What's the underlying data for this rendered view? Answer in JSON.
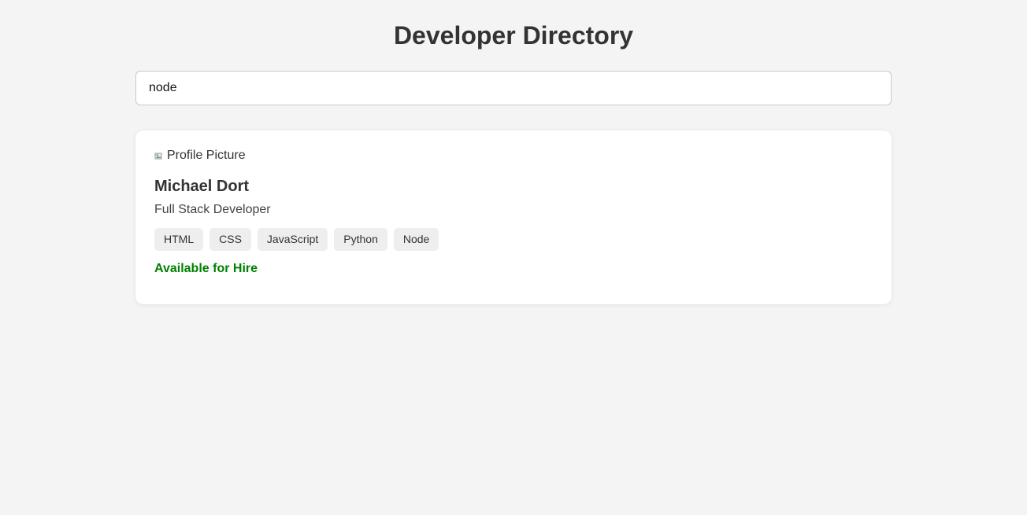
{
  "header": {
    "title": "Developer Directory"
  },
  "search": {
    "value": "node"
  },
  "results": [
    {
      "profile_picture_alt": "Profile Picture",
      "name": "Michael Dort",
      "role": "Full Stack Developer",
      "skills": [
        "HTML",
        "CSS",
        "JavaScript",
        "Python",
        "Node"
      ],
      "availability": "Available for Hire",
      "availability_color": "#008000"
    }
  ],
  "colors": {
    "background": "#f4f4f4",
    "card": "#ffffff",
    "tag": "#eeeeee",
    "text": "#333333"
  },
  "icons": {
    "profile_picture": "broken-image-icon"
  }
}
